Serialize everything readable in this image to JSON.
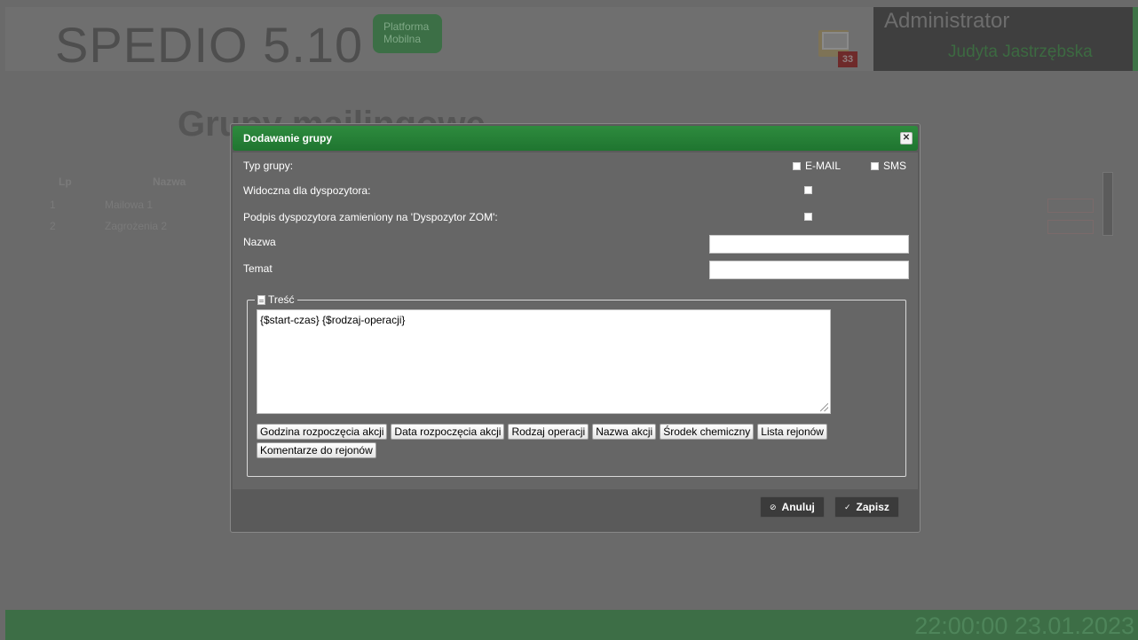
{
  "app": {
    "logo": "SPEDIO 5.10",
    "platform_badge_line1": "Platforma",
    "platform_badge_line2": "Mobilna",
    "mail_count": "33",
    "user_role": "Administrator",
    "user_name": "Judyta Jastrzębska"
  },
  "background_page": {
    "title": "Grupy mailingowe",
    "columns": [
      "Lp",
      "Nazwa"
    ],
    "rows": [
      {
        "lp": "1",
        "nazwa": "Mailowa 1"
      },
      {
        "lp": "2",
        "nazwa": "Zagrożenia 2"
      }
    ]
  },
  "footer": {
    "time": "22:00:00",
    "date": "23.01.2023"
  },
  "dialog": {
    "title": "Dodawanie grupy",
    "close_icon": "close-icon",
    "group_type_label": "Typ grupy:",
    "email_label": "E-MAIL",
    "sms_label": "SMS",
    "visible_label": "Widoczna dla dyspozytora:",
    "signature_label": "Podpis dyspozytora zamieniony na 'Dyspozytor ZOM':",
    "name_label": "Nazwa",
    "name_value": "",
    "subject_label": "Temat",
    "subject_value": "",
    "content_legend": "Treść",
    "content_value": "{$start-czas} {$rodzaj-operacji}",
    "tag_buttons": [
      "Godzina rozpoczęcia akcji",
      "Data rozpoczęcia akcji",
      "Rodzaj operacji",
      "Nazwa akcji",
      "Środek chemiczny",
      "Lista rejonów",
      "Komentarze do rejonów"
    ],
    "cancel_label": "Anuluj",
    "save_label": "Zapisz"
  },
  "colors": {
    "header_green": "#1f7530",
    "footer_green": "#3d6e46",
    "button_dark": "#3b3b3b"
  }
}
